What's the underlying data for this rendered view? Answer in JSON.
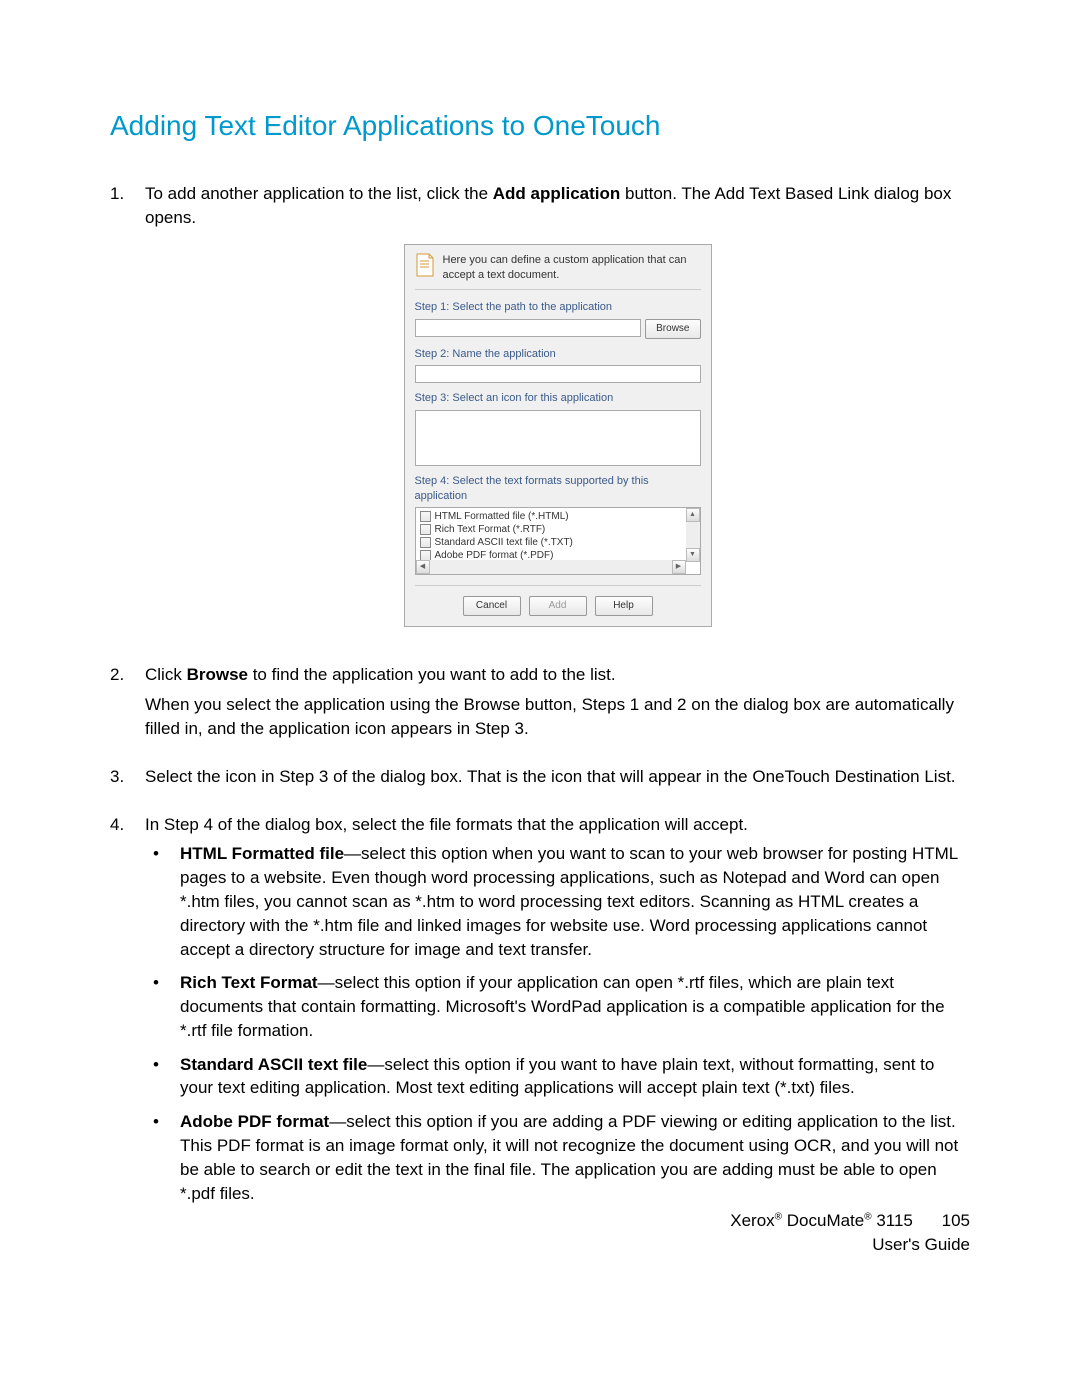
{
  "heading": "Adding Text Editor Applications to OneTouch",
  "steps": {
    "s1": {
      "num": "1.",
      "text_a": "To add another application to the list, click the ",
      "bold": "Add application",
      "text_b": " button. The Add Text Based Link dialog box opens."
    },
    "s2": {
      "num": "2.",
      "line1_a": "Click ",
      "line1_bold": "Browse",
      "line1_b": " to find the application you want to add to the list.",
      "line2": "When you select the application using the Browse button, Steps 1 and 2 on the dialog box are automatically filled in, and the application icon appears in Step 3."
    },
    "s3": {
      "num": "3.",
      "text": "Select the icon in Step 3 of the dialog box. That is the icon that will appear in the OneTouch Destination List."
    },
    "s4": {
      "num": "4.",
      "text": "In Step 4 of the dialog box, select the file formats that the application will accept."
    }
  },
  "bullets": {
    "b1": {
      "bold": "HTML Formatted file",
      "text": "—select this option when you want to scan to your web browser for posting HTML pages to a website. Even though word processing applications, such as Notepad and Word can open *.htm files, you cannot scan as *.htm to word processing text editors. Scanning as HTML creates a directory with the *.htm file and linked images for website use. Word processing applications cannot accept a directory structure for image and text transfer."
    },
    "b2": {
      "bold": "Rich Text Format",
      "text": "—select this option if your application can open *.rtf files, which are plain text documents that contain formatting. Microsoft's WordPad application is a compatible application for the *.rtf file formation."
    },
    "b3": {
      "bold": "Standard ASCII text file",
      "text": "—select this option if you want to have plain text, without formatting, sent to your text editing application. Most text editing applications will accept plain text (*.txt) files."
    },
    "b4": {
      "bold": "Adobe PDF format",
      "text": "—select this option if you are adding a PDF viewing or editing application to the list. This PDF format is an image format only, it will not recognize the document using OCR, and you will not be able to search or edit the text in the final file. The application you are adding must be able to open *.pdf files."
    }
  },
  "dialog": {
    "header": "Here you can define a custom application that can accept a text document.",
    "step1": "Step 1: Select the path to the application",
    "browse": "Browse",
    "step2": "Step 2: Name the application",
    "step3": "Step 3: Select an icon for this application",
    "step4": "Step 4: Select the text formats supported by this application",
    "formats": {
      "f1": "HTML Formatted file (*.HTML)",
      "f2": "Rich Text Format (*.RTF)",
      "f3": "Standard ASCII text file (*.TXT)",
      "f4": "Adobe PDF format (*.PDF)"
    },
    "btn_cancel": "Cancel",
    "btn_add": "Add",
    "btn_help": "Help"
  },
  "footer": {
    "line1_a": "Xerox",
    "line1_b": " DocuMate",
    "line1_c": " 3115",
    "pagenum": "105",
    "line2": "User's Guide"
  }
}
